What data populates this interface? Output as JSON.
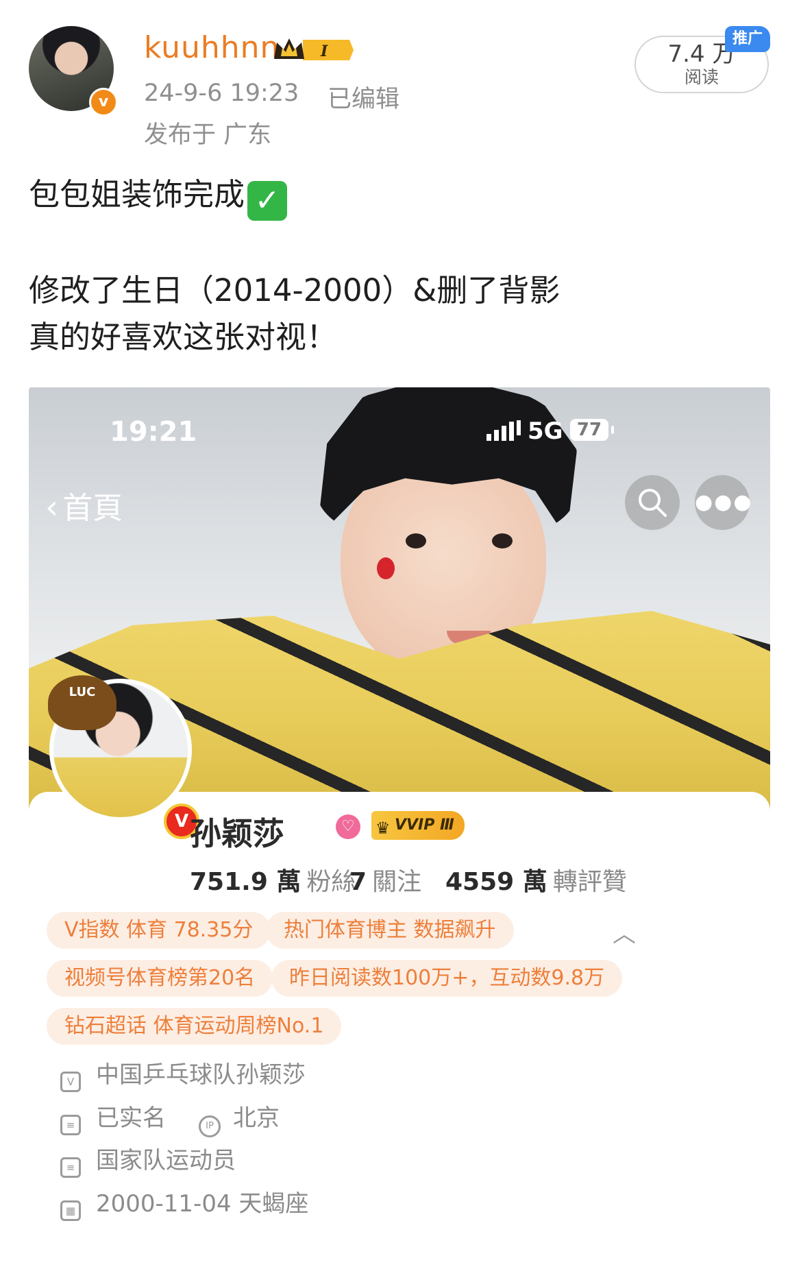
{
  "post": {
    "username": "kuuhhnn",
    "level_badge": "I",
    "time": "24-9-6 19:23",
    "edited": "已编辑",
    "location": "发布于 广东",
    "read_count": "7.4 万",
    "read_label": "阅读",
    "promo_tag": "推广",
    "verified_icon": "v-verified-icon",
    "text_lines": [
      "包包姐装饰完成",
      "修改了生日（2014-2000）&删了背影",
      "真的好喜欢这张对视！"
    ],
    "check_emoji": "✓"
  },
  "screenshot": {
    "status_time": "19:21",
    "network": "5G",
    "battery": "77",
    "back_label": "首頁",
    "profile": {
      "name": "孙颖莎",
      "vip_label": "VVIP Ⅲ",
      "avatar_deco_text": "LUC",
      "verified_mark": "V",
      "stats": [
        {
          "value": "751.9 萬",
          "label": "粉絲"
        },
        {
          "value": "7",
          "label": "關注"
        },
        {
          "value": "4559 萬",
          "label": "轉評贊"
        }
      ],
      "tags": [
        "V指数 体育 78.35分",
        "热门体育博主 数据飙升",
        "视频号体育榜第20名",
        "昨日阅读数100万+，互动数9.8万",
        "钻石超话 体育运动周榜No.1"
      ],
      "info": {
        "title": "中国乒乓球队孙颖莎",
        "real_name": "已实名",
        "ip_label": "IP",
        "ip_location": "北京",
        "occupation": "国家队运动员",
        "birthday": "2000-11-04 天蝎座"
      }
    }
  },
  "colors": {
    "username": "#eb7c23",
    "meta_gray": "#8f8f8f",
    "tag_bg": "#fdeee4",
    "tag_text": "#ed7f3a",
    "promo_blue": "#3a8af0"
  }
}
